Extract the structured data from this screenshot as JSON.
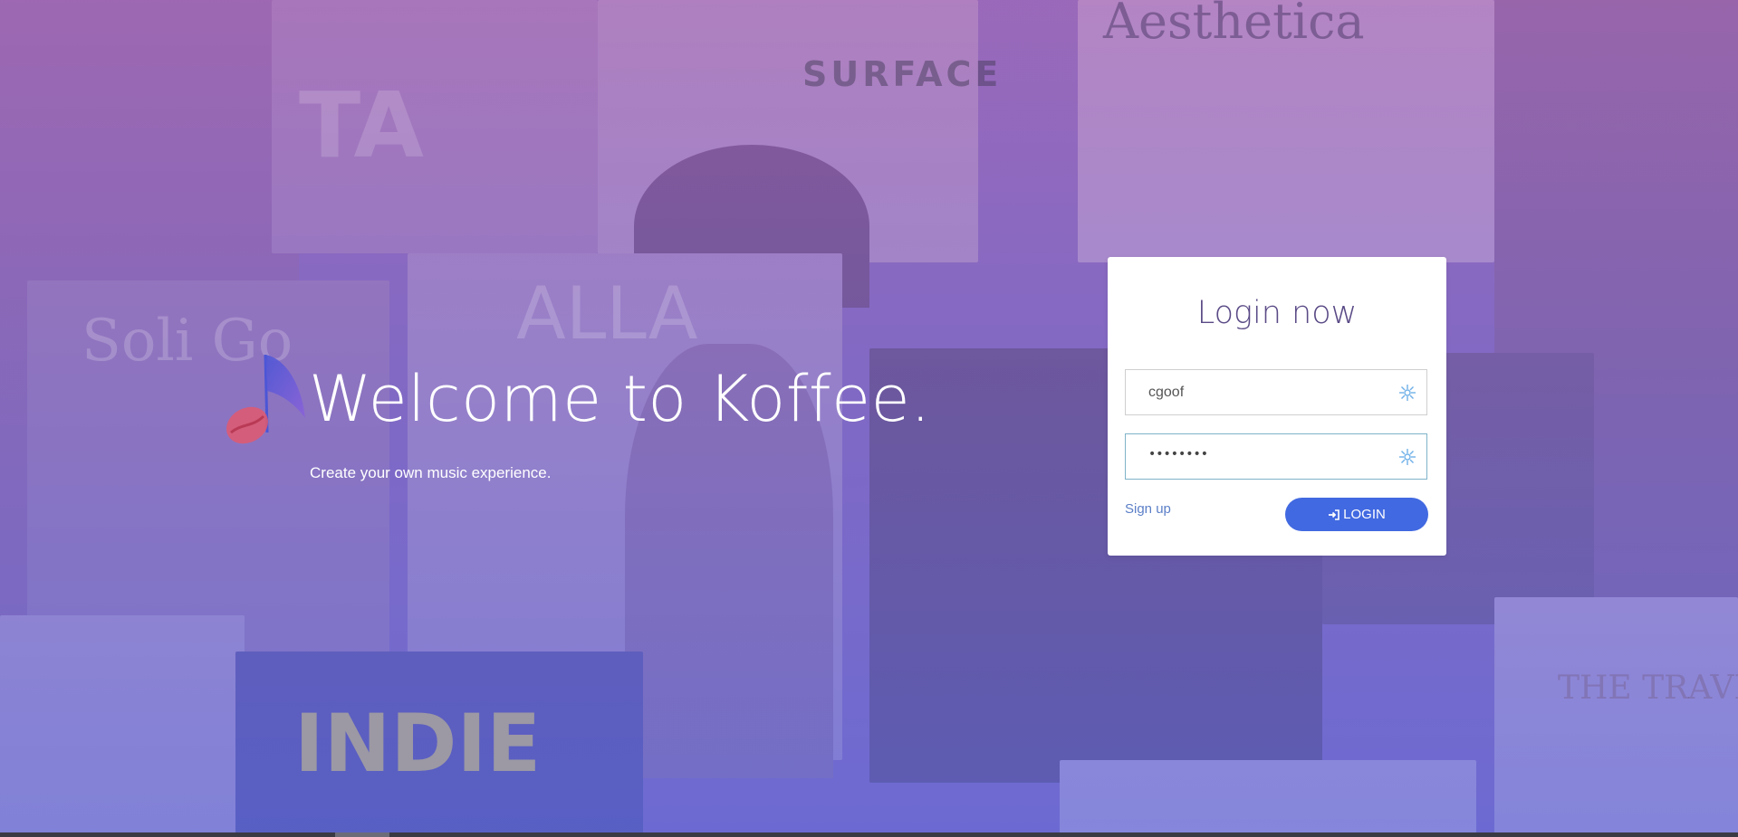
{
  "hero": {
    "title": "Welcome to Koffee.",
    "subtitle": "Create your own music experience.",
    "logo_icon": "music-note-coffee-bean-logo"
  },
  "login": {
    "title": "Login now",
    "username": {
      "value": "cgoof",
      "icon": "snowflake-icon"
    },
    "password": {
      "value": "••••••••",
      "icon": "snowflake-icon"
    },
    "signup_label": "Sign up",
    "login_label": "LOGIN",
    "login_icon": "sign-in-icon"
  },
  "background": {
    "magazine_titles": [
      "Aesthetica",
      "SURFACE",
      "INDIE",
      "THE TRAVE",
      "Soli Go",
      "ALLA",
      "TA"
    ]
  },
  "colors": {
    "accent": "#4169e1",
    "overlay_top": "#a368b7",
    "overlay_bottom": "#686ad6",
    "title_text": "#5a4a86",
    "link": "#5b7fc7"
  }
}
